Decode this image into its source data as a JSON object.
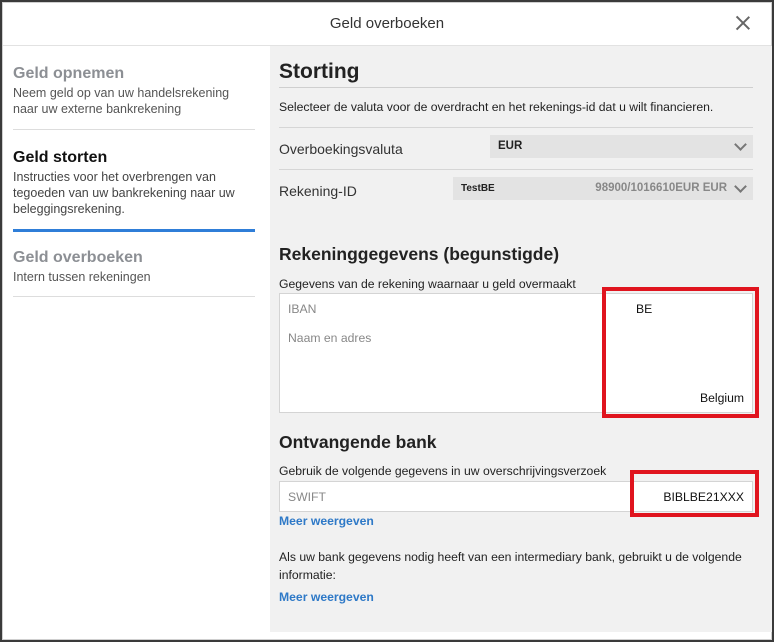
{
  "dialog": {
    "title": "Geld overboeken"
  },
  "sidebar": {
    "items": [
      {
        "title": "Geld opnemen",
        "desc": "Neem geld op van uw handelsrekening naar uw externe bankrekening"
      },
      {
        "title": "Geld storten",
        "desc": "Instructies voor het overbrengen van tegoeden van uw bankrekening naar uw beleggingsrekening."
      },
      {
        "title": "Geld overboeken",
        "desc": "Intern tussen rekeningen"
      }
    ]
  },
  "main": {
    "heading": "Storting",
    "intro": "Selecteer de valuta voor de overdracht en het rekenings-id dat u wilt financieren.",
    "currency": {
      "label": "Overboekingsvaluta",
      "value": "EUR"
    },
    "account": {
      "label": "Rekening-ID",
      "name": "TestBE",
      "value": "98900/1016610EUR EUR"
    },
    "beneficiary": {
      "heading": "Rekeninggegevens (begunstigde)",
      "sub": "Gegevens van de rekening waarnaar u geld overmaakt",
      "iban_placeholder": "IBAN",
      "iban_value": "BE",
      "name_placeholder": "Naam en adres",
      "name_value": "Belgium"
    },
    "bank": {
      "heading": "Ontvangende bank",
      "sub": "Gebruik de volgende gegevens in uw overschrijvingsverzoek",
      "swift_placeholder": "SWIFT",
      "swift_value": "BIBLBE21XXX",
      "more": "Meer weergeven"
    },
    "intermediary": {
      "note": "Als uw bank gegevens nodig heeft van een intermediary bank, gebruikt u de volgende informatie:",
      "more": "Meer weergeven"
    }
  },
  "colors": {
    "accent": "#2f7ed8",
    "link": "#2e79c7",
    "highlight": "#e0141e"
  }
}
